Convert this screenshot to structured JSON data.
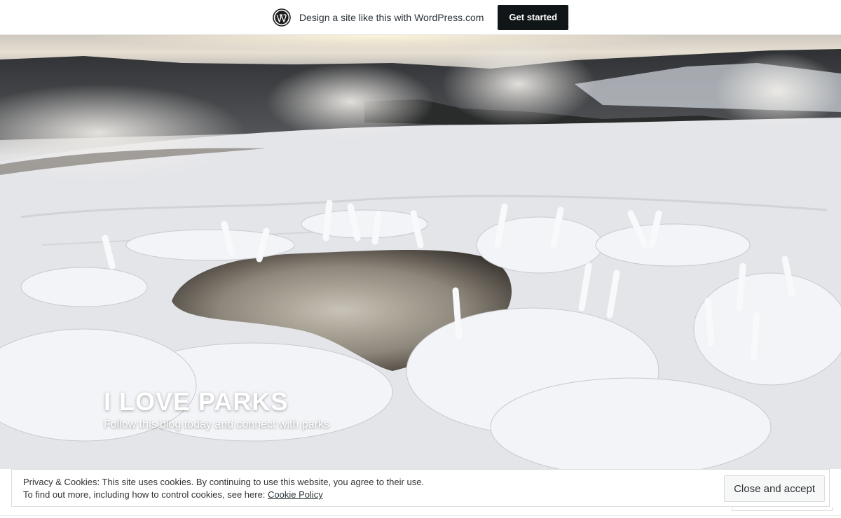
{
  "banner": {
    "text": "Design a site like this with WordPress.com",
    "cta_label": "Get started",
    "logo_icon": "wordpress-logo-icon"
  },
  "hero": {
    "title": "I LOVE PARKS",
    "tagline": "Follow this blog today and connect with parks"
  },
  "cookie": {
    "line1": "Privacy & Cookies: This site uses cookies. By continuing to use this website, you agree to their use.",
    "line2_prefix": "To find out more, including how to control cookies, see here: ",
    "link_label": "Cookie Policy",
    "button_label": "Close and accept"
  },
  "colors": {
    "cta_background": "#101517",
    "title_text": "#ffffff"
  }
}
